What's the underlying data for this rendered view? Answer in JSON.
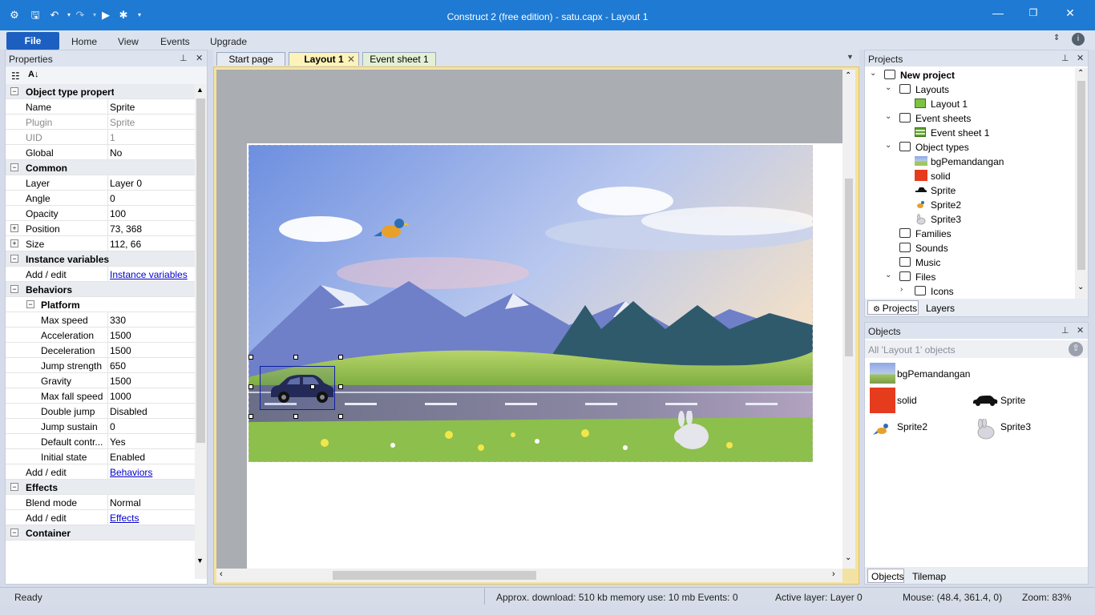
{
  "window": {
    "title": "Construct 2  (free edition) - satu.capx - Layout 1"
  },
  "ribbon": {
    "file": "File",
    "tabs": [
      "Home",
      "View",
      "Events",
      "Upgrade"
    ]
  },
  "properties": {
    "title": "Properties",
    "rows": [
      {
        "type": "cat",
        "label": "Object type properties",
        "toggle": "−"
      },
      {
        "label": "Name",
        "value": "Sprite"
      },
      {
        "label": "Plugin",
        "value": "Sprite",
        "dim": true
      },
      {
        "label": "UID",
        "value": "1",
        "dim": true
      },
      {
        "label": "Global",
        "value": "No"
      },
      {
        "type": "cat",
        "label": "Common",
        "toggle": "−"
      },
      {
        "label": "Layer",
        "value": "Layer 0"
      },
      {
        "label": "Angle",
        "value": "0"
      },
      {
        "label": "Opacity",
        "value": "100"
      },
      {
        "label": "Position",
        "value": "73, 368",
        "toggle": "+"
      },
      {
        "label": "Size",
        "value": "112, 66",
        "toggle": "+"
      },
      {
        "type": "cat",
        "label": "Instance variables",
        "toggle": "−"
      },
      {
        "label": "Add / edit",
        "value": "Instance variables",
        "link": true
      },
      {
        "type": "cat",
        "label": "Behaviors",
        "toggle": "−"
      },
      {
        "type": "subcat",
        "label": "Platform",
        "toggle": "−"
      },
      {
        "label": "Max speed",
        "value": "330",
        "indent": true
      },
      {
        "label": "Acceleration",
        "value": "1500",
        "indent": true
      },
      {
        "label": "Deceleration",
        "value": "1500",
        "indent": true
      },
      {
        "label": "Jump strength",
        "value": "650",
        "indent": true
      },
      {
        "label": "Gravity",
        "value": "1500",
        "indent": true
      },
      {
        "label": "Max fall speed",
        "value": "1000",
        "indent": true
      },
      {
        "label": "Double jump",
        "value": "Disabled",
        "indent": true
      },
      {
        "label": "Jump sustain",
        "value": "0",
        "indent": true
      },
      {
        "label": "Default contr...",
        "value": "Yes",
        "indent": true
      },
      {
        "label": "Initial state",
        "value": "Enabled",
        "indent": true
      },
      {
        "label": "Add / edit",
        "value": "Behaviors",
        "link": true
      },
      {
        "type": "cat",
        "label": "Effects",
        "toggle": "−"
      },
      {
        "label": "Blend mode",
        "value": "Normal"
      },
      {
        "label": "Add / edit",
        "value": "Effects",
        "link": true
      },
      {
        "type": "cat",
        "label": "Container",
        "toggle": "−"
      }
    ]
  },
  "doc_tabs": [
    "Start page",
    "Layout 1",
    "Event sheet 1"
  ],
  "projects": {
    "title": "Projects",
    "tree": [
      {
        "label": "New project",
        "depth": 0,
        "kind": "folder",
        "bold": true,
        "chev": "v"
      },
      {
        "label": "Layouts",
        "depth": 1,
        "kind": "folder",
        "chev": "v"
      },
      {
        "label": "Layout 1",
        "depth": 2,
        "kind": "layout"
      },
      {
        "label": "Event sheets",
        "depth": 1,
        "kind": "folder",
        "chev": "v"
      },
      {
        "label": "Event sheet 1",
        "depth": 2,
        "kind": "sheet"
      },
      {
        "label": "Object types",
        "depth": 1,
        "kind": "folder",
        "chev": "v"
      },
      {
        "label": "bgPemandangan",
        "depth": 2,
        "kind": "bg"
      },
      {
        "label": "solid",
        "depth": 2,
        "kind": "solid"
      },
      {
        "label": "Sprite",
        "depth": 2,
        "kind": "car"
      },
      {
        "label": "Sprite2",
        "depth": 2,
        "kind": "bird"
      },
      {
        "label": "Sprite3",
        "depth": 2,
        "kind": "rabbit"
      },
      {
        "label": "Families",
        "depth": 1,
        "kind": "folder"
      },
      {
        "label": "Sounds",
        "depth": 1,
        "kind": "folder"
      },
      {
        "label": "Music",
        "depth": 1,
        "kind": "folder"
      },
      {
        "label": "Files",
        "depth": 1,
        "kind": "folder",
        "chev": "v"
      },
      {
        "label": "Icons",
        "depth": 2,
        "kind": "folder",
        "chev": ">"
      }
    ],
    "tabs": [
      "Projects",
      "Layers"
    ]
  },
  "objects": {
    "title": "Objects",
    "filter": "All 'Layout 1' objects",
    "items": [
      "bgPemandangan",
      "solid",
      "Sprite",
      "Sprite2",
      "Sprite3"
    ],
    "tabs": [
      "Objects",
      "Tilemap"
    ]
  },
  "status": {
    "ready": "Ready",
    "download": "Approx. download: 510 kb  memory use: 10 mb  Events: 0",
    "layer": "Active layer: Layer 0",
    "mouse": "Mouse: (48.4, 361.4, 0)",
    "zoom": "Zoom: 83%"
  },
  "colors": {
    "titlebar": "#1e7ad3",
    "accent": "#1c5fc0",
    "solid": "#e63c1e"
  }
}
